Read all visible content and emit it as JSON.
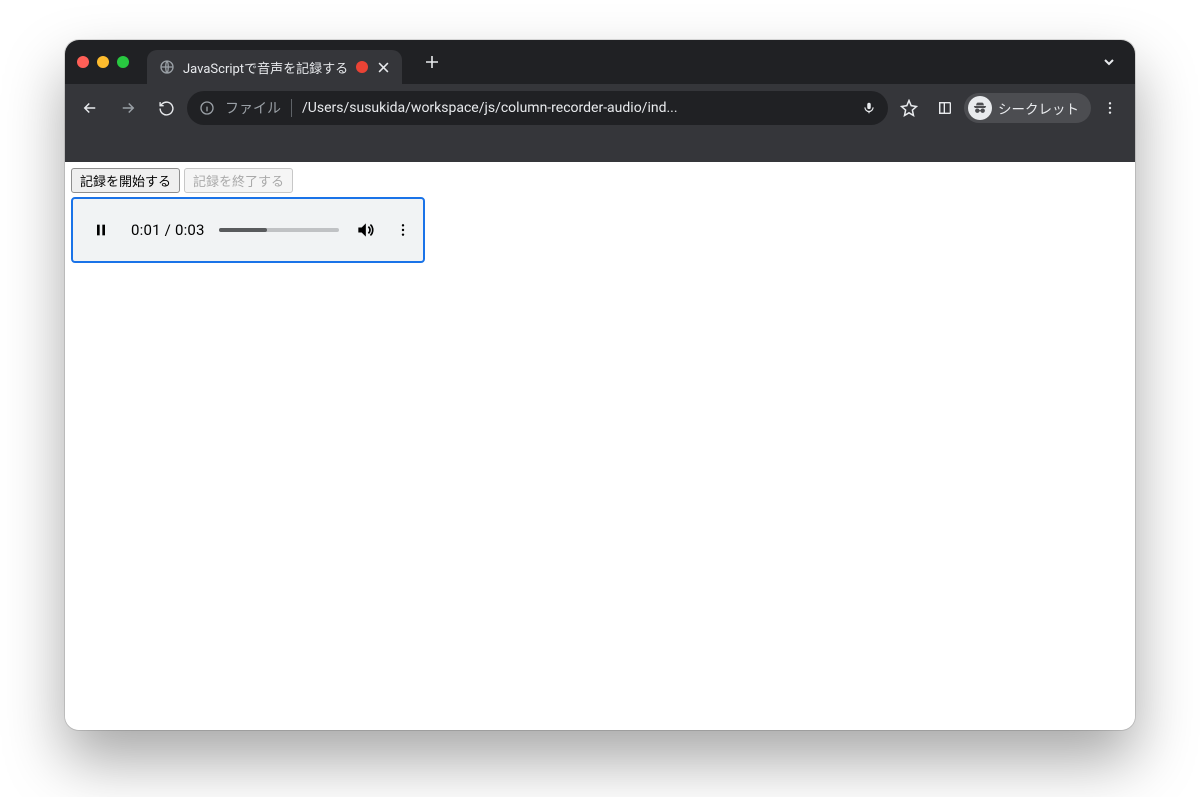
{
  "browser": {
    "tab_title": "JavaScriptで音声を記録する",
    "url_scheme_label": "ファイル",
    "url_path": "/Users/susukida/workspace/js/column-recorder-audio/ind...",
    "incognito_label": "シークレット"
  },
  "page": {
    "start_button_label": "記録を開始する",
    "stop_button_label": "記録を終了する"
  },
  "audio": {
    "current_time": "0:01",
    "duration": "0:03",
    "time_separator": " / ",
    "progress_percent": 40
  }
}
